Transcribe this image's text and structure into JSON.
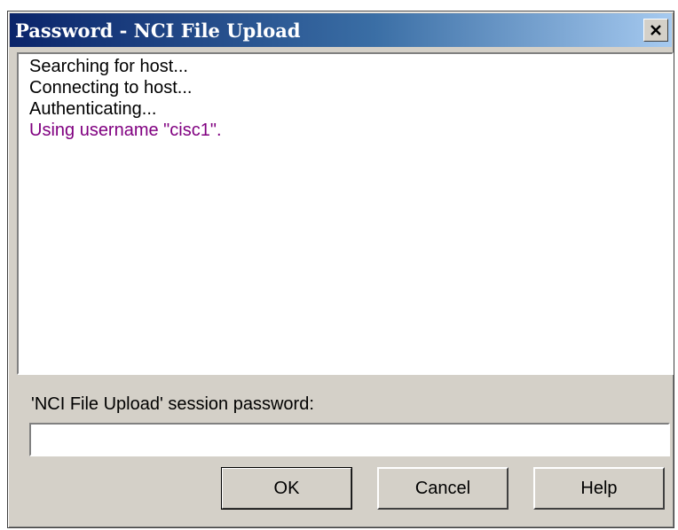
{
  "window": {
    "title": "Password - NCI File Upload",
    "close_glyph": "✕"
  },
  "log": {
    "lines": [
      {
        "text": "Searching for host...",
        "color": "#000000"
      },
      {
        "text": "Connecting to host...",
        "color": "#000000"
      },
      {
        "text": "Authenticating...",
        "color": "#000000"
      },
      {
        "text": "Using username \"cisc1\".",
        "color": "#800080"
      }
    ]
  },
  "password": {
    "label": "'NCI File Upload' session password:",
    "value": ""
  },
  "buttons": {
    "ok": "OK",
    "cancel": "Cancel",
    "help": "Help"
  },
  "colors": {
    "titlebar_start": "#0a246a",
    "titlebar_end": "#a6caf0",
    "dialog_face": "#d4d0c8",
    "highlight_text": "#800080"
  }
}
